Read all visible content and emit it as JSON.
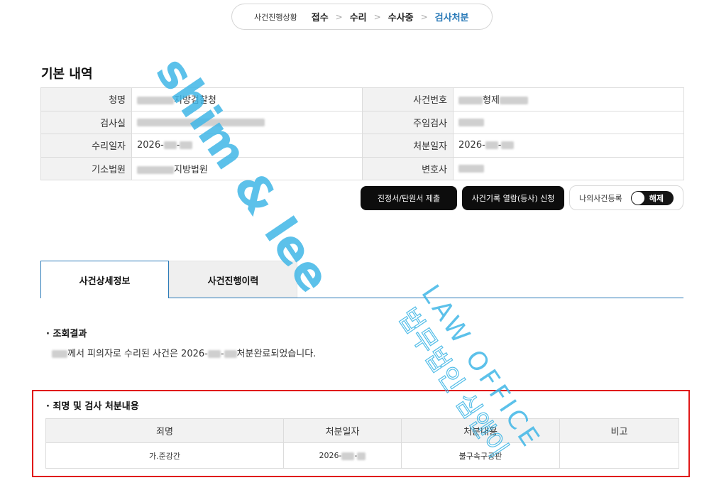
{
  "progress": {
    "label": "사건진행상황",
    "steps": [
      "접수",
      "수리",
      "수사중",
      "검사처분"
    ],
    "separator": ">"
  },
  "basic": {
    "title": "기본 내역",
    "rows": [
      {
        "k1": "청명",
        "v1": "지방검찰청",
        "k2": "사건번호",
        "v2": "형제"
      },
      {
        "k1": "검사실",
        "v1": "",
        "k2": "주임검사",
        "v2": ""
      },
      {
        "k1": "수리일자",
        "v1": "2026-",
        "k2": "처분일자",
        "v2": "2026-"
      },
      {
        "k1": "기소법원",
        "v1": "지방법원",
        "k2": "변호사",
        "v2": ""
      }
    ]
  },
  "actions": {
    "petition": "진정서/탄원서 제출",
    "records": "사건기록 열람(등사) 신청",
    "my_case": "나의사건등록",
    "toggle": "해제"
  },
  "tabs": [
    "사건상세정보",
    "사건진행이력"
  ],
  "inquiry": {
    "title": "조회결과",
    "text_a": "께서 피의자로 수리된 사건은 2026-",
    "text_b": "처분완료되었습니다."
  },
  "charges": {
    "title": "죄명 및 검사 처분내용",
    "headers": [
      "죄명",
      "처분일자",
      "처분내용",
      "비고"
    ],
    "rows": [
      {
        "name": "가.준강간",
        "date": "2026-",
        "result": "불구속구공판",
        "note": ""
      }
    ]
  },
  "watermark": {
    "brand": "shim & lee",
    "office": "LAW OFFICE",
    "korean": "법무법인 심앤이",
    "color": "#3fb6e6"
  },
  "colors": {
    "accent": "#2a7ab8",
    "highlight": "#e01818",
    "button_dark": "#0d0d0d"
  }
}
